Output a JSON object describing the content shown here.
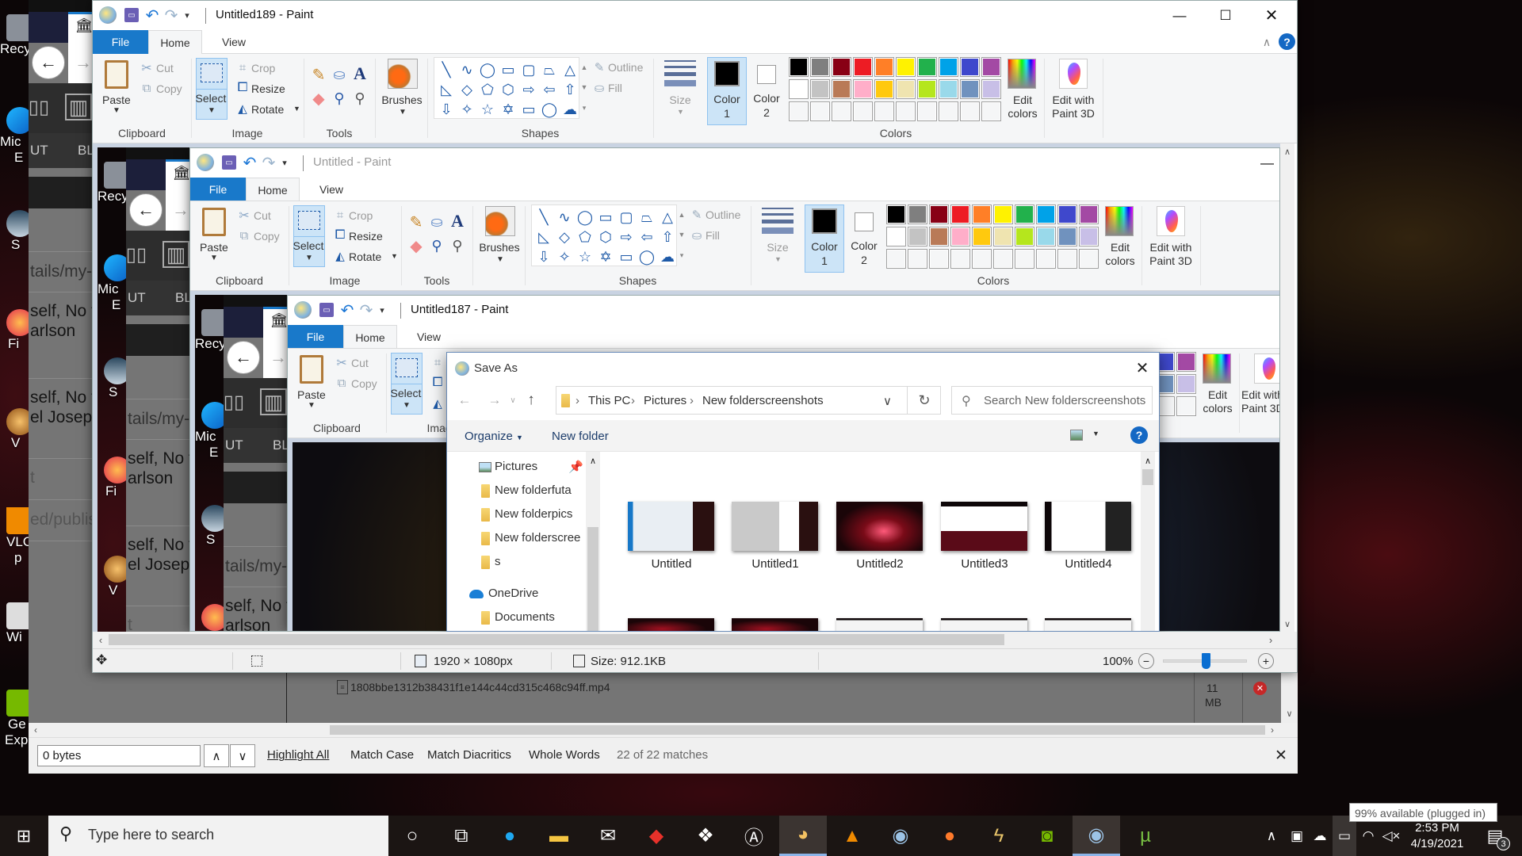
{
  "desktop": {
    "icons": [
      "Recy",
      "Mic",
      "E",
      "S",
      "Fi",
      "V",
      "VLC",
      "p",
      "Wi",
      "Ge",
      "Exp"
    ]
  },
  "browser": {
    "strip": {
      "col_a": "UT",
      "col_b": "BL",
      "rows": [
        "tails/my-m",
        "self, No fre",
        "arlson",
        "self, No fre",
        "el Joseph",
        "t",
        "ed/publishe"
      ]
    },
    "file_row": {
      "name": "1808bbe1312b38431f1e144c44cd315c468c94ff.mp4",
      "size_value": "11",
      "size_unit": "MB"
    }
  },
  "find_bar": {
    "value": "0 bytes",
    "highlight_all": "Highlight All",
    "match_case": "Match Case",
    "match_diacritics": "Match Diacritics",
    "whole_words": "Whole Words",
    "status": "22 of 22 matches"
  },
  "paint": {
    "titles": [
      "Untitled189 - Paint",
      "Untitled - Paint",
      "Untitled187 - Paint"
    ],
    "tabs": {
      "file": "File",
      "home": "Home",
      "view": "View"
    },
    "clipboard": {
      "paste": "Paste",
      "cut": "Cut",
      "copy": "Copy",
      "label": "Clipboard"
    },
    "image": {
      "select": "Select",
      "crop": "Crop",
      "resize": "Resize",
      "rotate": "Rotate",
      "label": "Image"
    },
    "tools": {
      "label": "Tools"
    },
    "brushes": {
      "label": "Brushes"
    },
    "shapes": {
      "label": "Shapes",
      "outline": "Outline",
      "fill": "Fill",
      "items": [
        "line",
        "curve",
        "oval",
        "rectangle",
        "rounded-rectangle",
        "polygon",
        "triangle",
        "right-triangle",
        "diamond",
        "pentagon",
        "hexagon",
        "right-arrow",
        "left-arrow",
        "up-arrow",
        "down-arrow",
        "four-point-star",
        "five-point-star",
        "six-point-star",
        "rounded-callout",
        "oval-callout",
        "cloud-callout"
      ]
    },
    "size": {
      "label": "Size"
    },
    "color1": {
      "label": "Color",
      "num": "1",
      "value": "#000000"
    },
    "color2": {
      "label": "Color",
      "num": "2",
      "value": "#ffffff"
    },
    "colors": {
      "label": "Colors",
      "palette": [
        "#000000",
        "#7f7f7f",
        "#880015",
        "#ed1c24",
        "#ff7f27",
        "#fff200",
        "#22b14c",
        "#00a2e8",
        "#3f48cc",
        "#a349a4",
        "#ffffff",
        "#c3c3c3",
        "#b97a57",
        "#ffaec9",
        "#ffc90e",
        "#efe4b0",
        "#b5e61d",
        "#99d9ea",
        "#7092be",
        "#c8bfe7"
      ]
    },
    "edit_colors": {
      "line1": "Edit",
      "line2": "colors"
    },
    "paint3d": {
      "line1": "Edit with",
      "line2": "Paint 3D"
    },
    "status": {
      "dimensions": "1920 × 1080px",
      "size": "Size: 912.1KB",
      "zoom": "100%",
      "zoom_slider_fraction": 0.5
    }
  },
  "save_as": {
    "title": "Save As",
    "breadcrumb": [
      "This PC",
      "Pictures",
      "New folderscreenshots"
    ],
    "search_placeholder": "Search New folderscreenshots",
    "organize": "Organize",
    "new_folder": "New folder",
    "nav": [
      "Pictures",
      "New folderfuta",
      "New folderpics",
      "New folderscree",
      "s",
      "OneDrive",
      "Documents"
    ],
    "files": [
      "Untitled",
      "Untitled1",
      "Untitled2",
      "Untitled3",
      "Untitled4"
    ]
  },
  "taskbar": {
    "search_placeholder": "Type here to search",
    "apps": [
      "cortana",
      "task-view",
      "edge",
      "file-explorer",
      "mail",
      "red-app",
      "dropbox",
      "circle-app",
      "paint",
      "vlc",
      "steam",
      "firefox",
      "lightning-app",
      "nvidia",
      "steam-active",
      "utorrent"
    ],
    "time": "2:53 PM",
    "date": "4/19/2021",
    "notifications": "3",
    "battery_tooltip": "99% available (plugged in)"
  }
}
